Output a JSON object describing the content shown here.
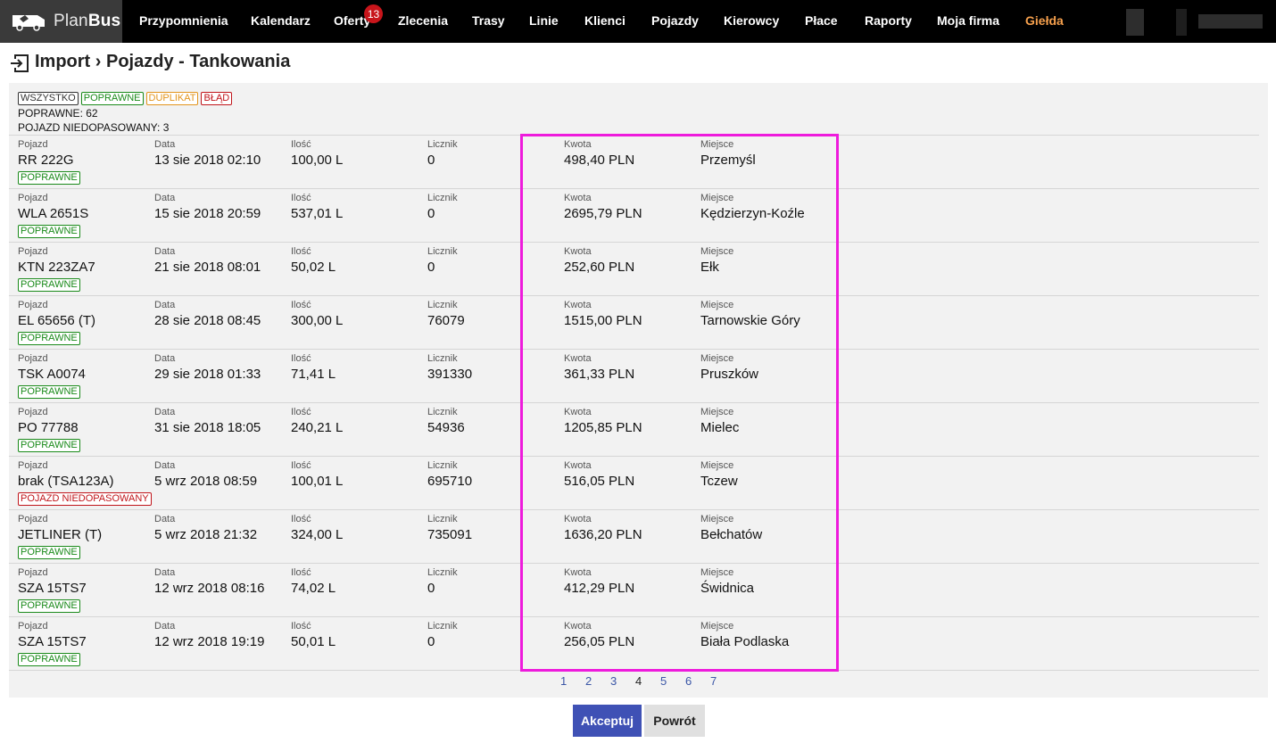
{
  "app": {
    "logo_plan": "Plan",
    "logo_bus": "Bus"
  },
  "nav": {
    "items": [
      "Przypomnienia",
      "Kalendarz",
      "Oferty",
      "Zlecenia",
      "Trasy",
      "Linie",
      "Klienci",
      "Pojazdy",
      "Kierowcy",
      "Płace",
      "Raporty",
      "Moja firma",
      "Giełda"
    ],
    "offers_badge": "13",
    "accent_color": "#f6a04d"
  },
  "page": {
    "title": "Import › Pojazdy - Tankowania"
  },
  "filters": {
    "all": "WSZYSTKO",
    "ok": "POPRAWNE",
    "dup": "DUPLIKAT",
    "err": "BŁĄD"
  },
  "summary": {
    "line1": "POPRAWNE: 62",
    "line2": "POJAZD NIEDOPASOWANY: 3"
  },
  "columns": {
    "vehicle": "Pojazd",
    "date": "Data",
    "qty": "Ilość",
    "counter": "Licznik",
    "amount": "Kwota",
    "place": "Miejsce"
  },
  "rows": [
    {
      "vehicle": "RR 222G",
      "date": "13 sie 2018 02:10",
      "qty": "100,00 L",
      "counter": "0",
      "amount": "498,40 PLN",
      "place": "Przemyśl",
      "status": "POPRAWNE",
      "status_type": "ok"
    },
    {
      "vehicle": "WLA 2651S",
      "date": "15 sie 2018 20:59",
      "qty": "537,01 L",
      "counter": "0",
      "amount": "2695,79 PLN",
      "place": "Kędzierzyn-Koźle",
      "status": "POPRAWNE",
      "status_type": "ok"
    },
    {
      "vehicle": "KTN 223ZA7",
      "date": "21 sie 2018 08:01",
      "qty": "50,02 L",
      "counter": "0",
      "amount": "252,60 PLN",
      "place": "Ełk",
      "status": "POPRAWNE",
      "status_type": "ok"
    },
    {
      "vehicle": "EL 65656 (T)",
      "date": "28 sie 2018 08:45",
      "qty": "300,00 L",
      "counter": "76079",
      "amount": "1515,00 PLN",
      "place": "Tarnowskie Góry",
      "status": "POPRAWNE",
      "status_type": "ok"
    },
    {
      "vehicle": "TSK A0074",
      "date": "29 sie 2018 01:33",
      "qty": "71,41 L",
      "counter": "391330",
      "amount": "361,33 PLN",
      "place": "Pruszków",
      "status": "POPRAWNE",
      "status_type": "ok"
    },
    {
      "vehicle": "PO 77788",
      "date": "31 sie 2018 18:05",
      "qty": "240,21 L",
      "counter": "54936",
      "amount": "1205,85 PLN",
      "place": "Mielec",
      "status": "POPRAWNE",
      "status_type": "ok"
    },
    {
      "vehicle": "brak (TSA123A)",
      "date": "5 wrz 2018 08:59",
      "qty": "100,01 L",
      "counter": "695710",
      "amount": "516,05 PLN",
      "place": "Tczew",
      "status": "POJAZD NIEDOPASOWANY",
      "status_type": "err"
    },
    {
      "vehicle": "JETLINER (T)",
      "date": "5 wrz 2018 21:32",
      "qty": "324,00 L",
      "counter": "735091",
      "amount": "1636,20 PLN",
      "place": "Bełchatów",
      "status": "POPRAWNE",
      "status_type": "ok"
    },
    {
      "vehicle": "SZA 15TS7",
      "date": "12 wrz 2018 08:16",
      "qty": "74,02 L",
      "counter": "0",
      "amount": "412,29 PLN",
      "place": "Świdnica",
      "status": "POPRAWNE",
      "status_type": "ok"
    },
    {
      "vehicle": "SZA 15TS7",
      "date": "12 wrz 2018 19:19",
      "qty": "50,01 L",
      "counter": "0",
      "amount": "256,05 PLN",
      "place": "Biała Podlaska",
      "status": "POPRAWNE",
      "status_type": "ok"
    }
  ],
  "pagination": {
    "pages": [
      "1",
      "2",
      "3",
      "4",
      "5",
      "6",
      "7"
    ],
    "current": "4"
  },
  "buttons": {
    "accept": "Akceptuj",
    "back": "Powrót"
  },
  "colors": {
    "highlight": "#ee1bdc",
    "primary": "#3f51b5",
    "ok": "#1a8a1a",
    "error": "#c0141a",
    "dup": "#e3941c"
  }
}
